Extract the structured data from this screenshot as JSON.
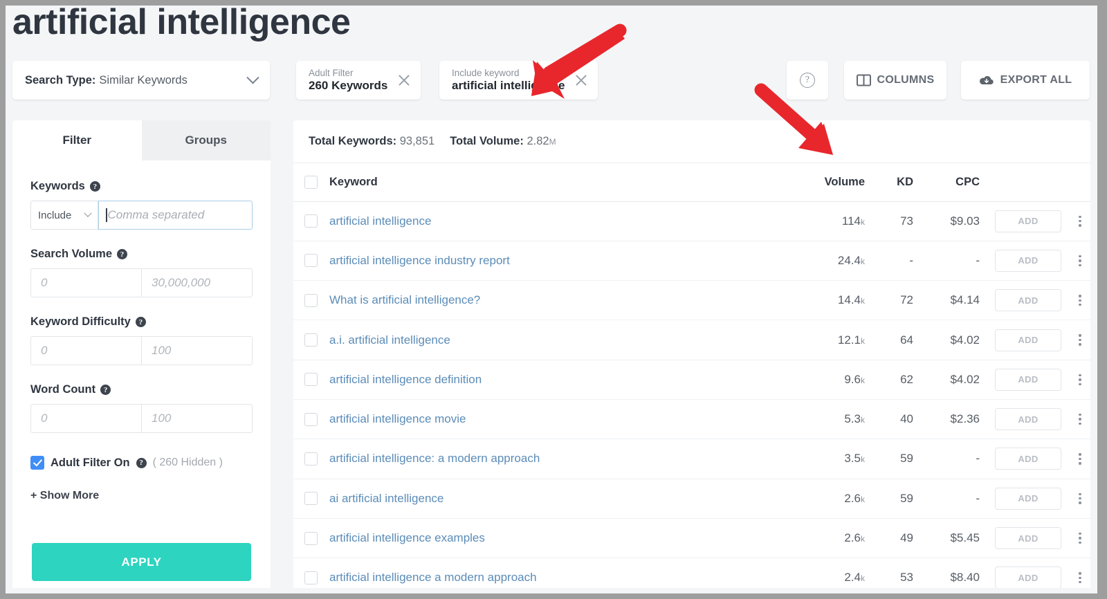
{
  "page": {
    "title": "artificial intelligence"
  },
  "toolbar": {
    "search_type_label": "Search Type:",
    "search_type_value": "Similar Keywords",
    "chips": [
      {
        "top": "Adult Filter",
        "bottom": "260 Keywords"
      },
      {
        "top": "Include keyword",
        "bottom": "artificial intelligence"
      }
    ],
    "help_glyph": "?",
    "columns_label": "COLUMNS",
    "export_label": "EXPORT ALL"
  },
  "sidebar": {
    "tabs": [
      {
        "label": "Filter",
        "active": true
      },
      {
        "label": "Groups",
        "active": false
      }
    ],
    "keywords": {
      "label": "Keywords",
      "mode_value": "Include",
      "input_placeholder": "Comma separated",
      "input_value": ""
    },
    "search_volume": {
      "label": "Search Volume",
      "min_placeholder": "0",
      "max_placeholder": "30,000,000"
    },
    "keyword_difficulty": {
      "label": "Keyword Difficulty",
      "min_placeholder": "0",
      "max_placeholder": "100"
    },
    "word_count": {
      "label": "Word Count",
      "min_placeholder": "0",
      "max_placeholder": "100"
    },
    "adult_filter": {
      "label": "Adult Filter On",
      "hidden_note": "( 260 Hidden )",
      "checked": true
    },
    "show_more_label": "+ Show More",
    "apply_label": "APPLY"
  },
  "totals": {
    "keywords_label": "Total Keywords:",
    "keywords_value": "93,851",
    "volume_label": "Total Volume:",
    "volume_value": "2.82",
    "volume_unit": "M"
  },
  "table": {
    "columns": [
      "Keyword",
      "Volume",
      "KD",
      "CPC"
    ],
    "add_label": "ADD",
    "rows": [
      {
        "keyword": "artificial intelligence",
        "volume": "114",
        "volume_unit": "k",
        "kd": "73",
        "cpc": "$9.03"
      },
      {
        "keyword": "artificial intelligence industry report",
        "volume": "24.4",
        "volume_unit": "k",
        "kd": "-",
        "cpc": "-"
      },
      {
        "keyword": "What is artificial intelligence?",
        "volume": "14.4",
        "volume_unit": "k",
        "kd": "72",
        "cpc": "$4.14"
      },
      {
        "keyword": "a.i. artificial intelligence",
        "volume": "12.1",
        "volume_unit": "k",
        "kd": "64",
        "cpc": "$4.02"
      },
      {
        "keyword": "artificial intelligence definition",
        "volume": "9.6",
        "volume_unit": "k",
        "kd": "62",
        "cpc": "$4.02"
      },
      {
        "keyword": "artificial intelligence movie",
        "volume": "5.3",
        "volume_unit": "k",
        "kd": "40",
        "cpc": "$2.36"
      },
      {
        "keyword": "artificial intelligence: a modern approach",
        "volume": "3.5",
        "volume_unit": "k",
        "kd": "59",
        "cpc": "-"
      },
      {
        "keyword": "ai artificial intelligence",
        "volume": "2.6",
        "volume_unit": "k",
        "kd": "59",
        "cpc": "-"
      },
      {
        "keyword": "artificial intelligence examples",
        "volume": "2.6",
        "volume_unit": "k",
        "kd": "49",
        "cpc": "$5.45"
      },
      {
        "keyword": "artificial intelligence a modern approach",
        "volume": "2.4",
        "volume_unit": "k",
        "kd": "53",
        "cpc": "$8.40"
      }
    ]
  },
  "annotations": {
    "arrow_color": "#e8272c",
    "arrows": [
      {
        "name": "arrow-to-include-keyword-chip"
      },
      {
        "name": "arrow-to-volume-column"
      }
    ]
  }
}
